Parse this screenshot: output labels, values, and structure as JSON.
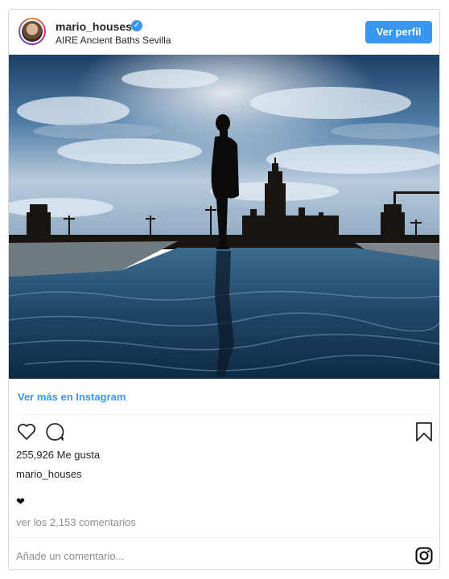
{
  "header": {
    "username": "mario_houses",
    "location": "AIRE Ancient Baths Sevilla",
    "verified_icon": "verified-badge-icon",
    "view_profile_label": "Ver perfil"
  },
  "post": {
    "see_more_label": "Ver más en Instagram",
    "likes_text": "255,926 Me gusta",
    "caption_username": "mario_houses",
    "caption_heart": "❤",
    "comments_link": "ver los 2,153 comentarios",
    "add_comment_placeholder": "Añade un comentario..."
  },
  "icons": {
    "like": "heart-icon",
    "comment": "comment-icon",
    "save": "bookmark-icon",
    "brand": "instagram-icon"
  },
  "colors": {
    "accent": "#3897f0",
    "border": "#dbdbdb",
    "text": "#262626",
    "muted": "#8e8e8e"
  }
}
